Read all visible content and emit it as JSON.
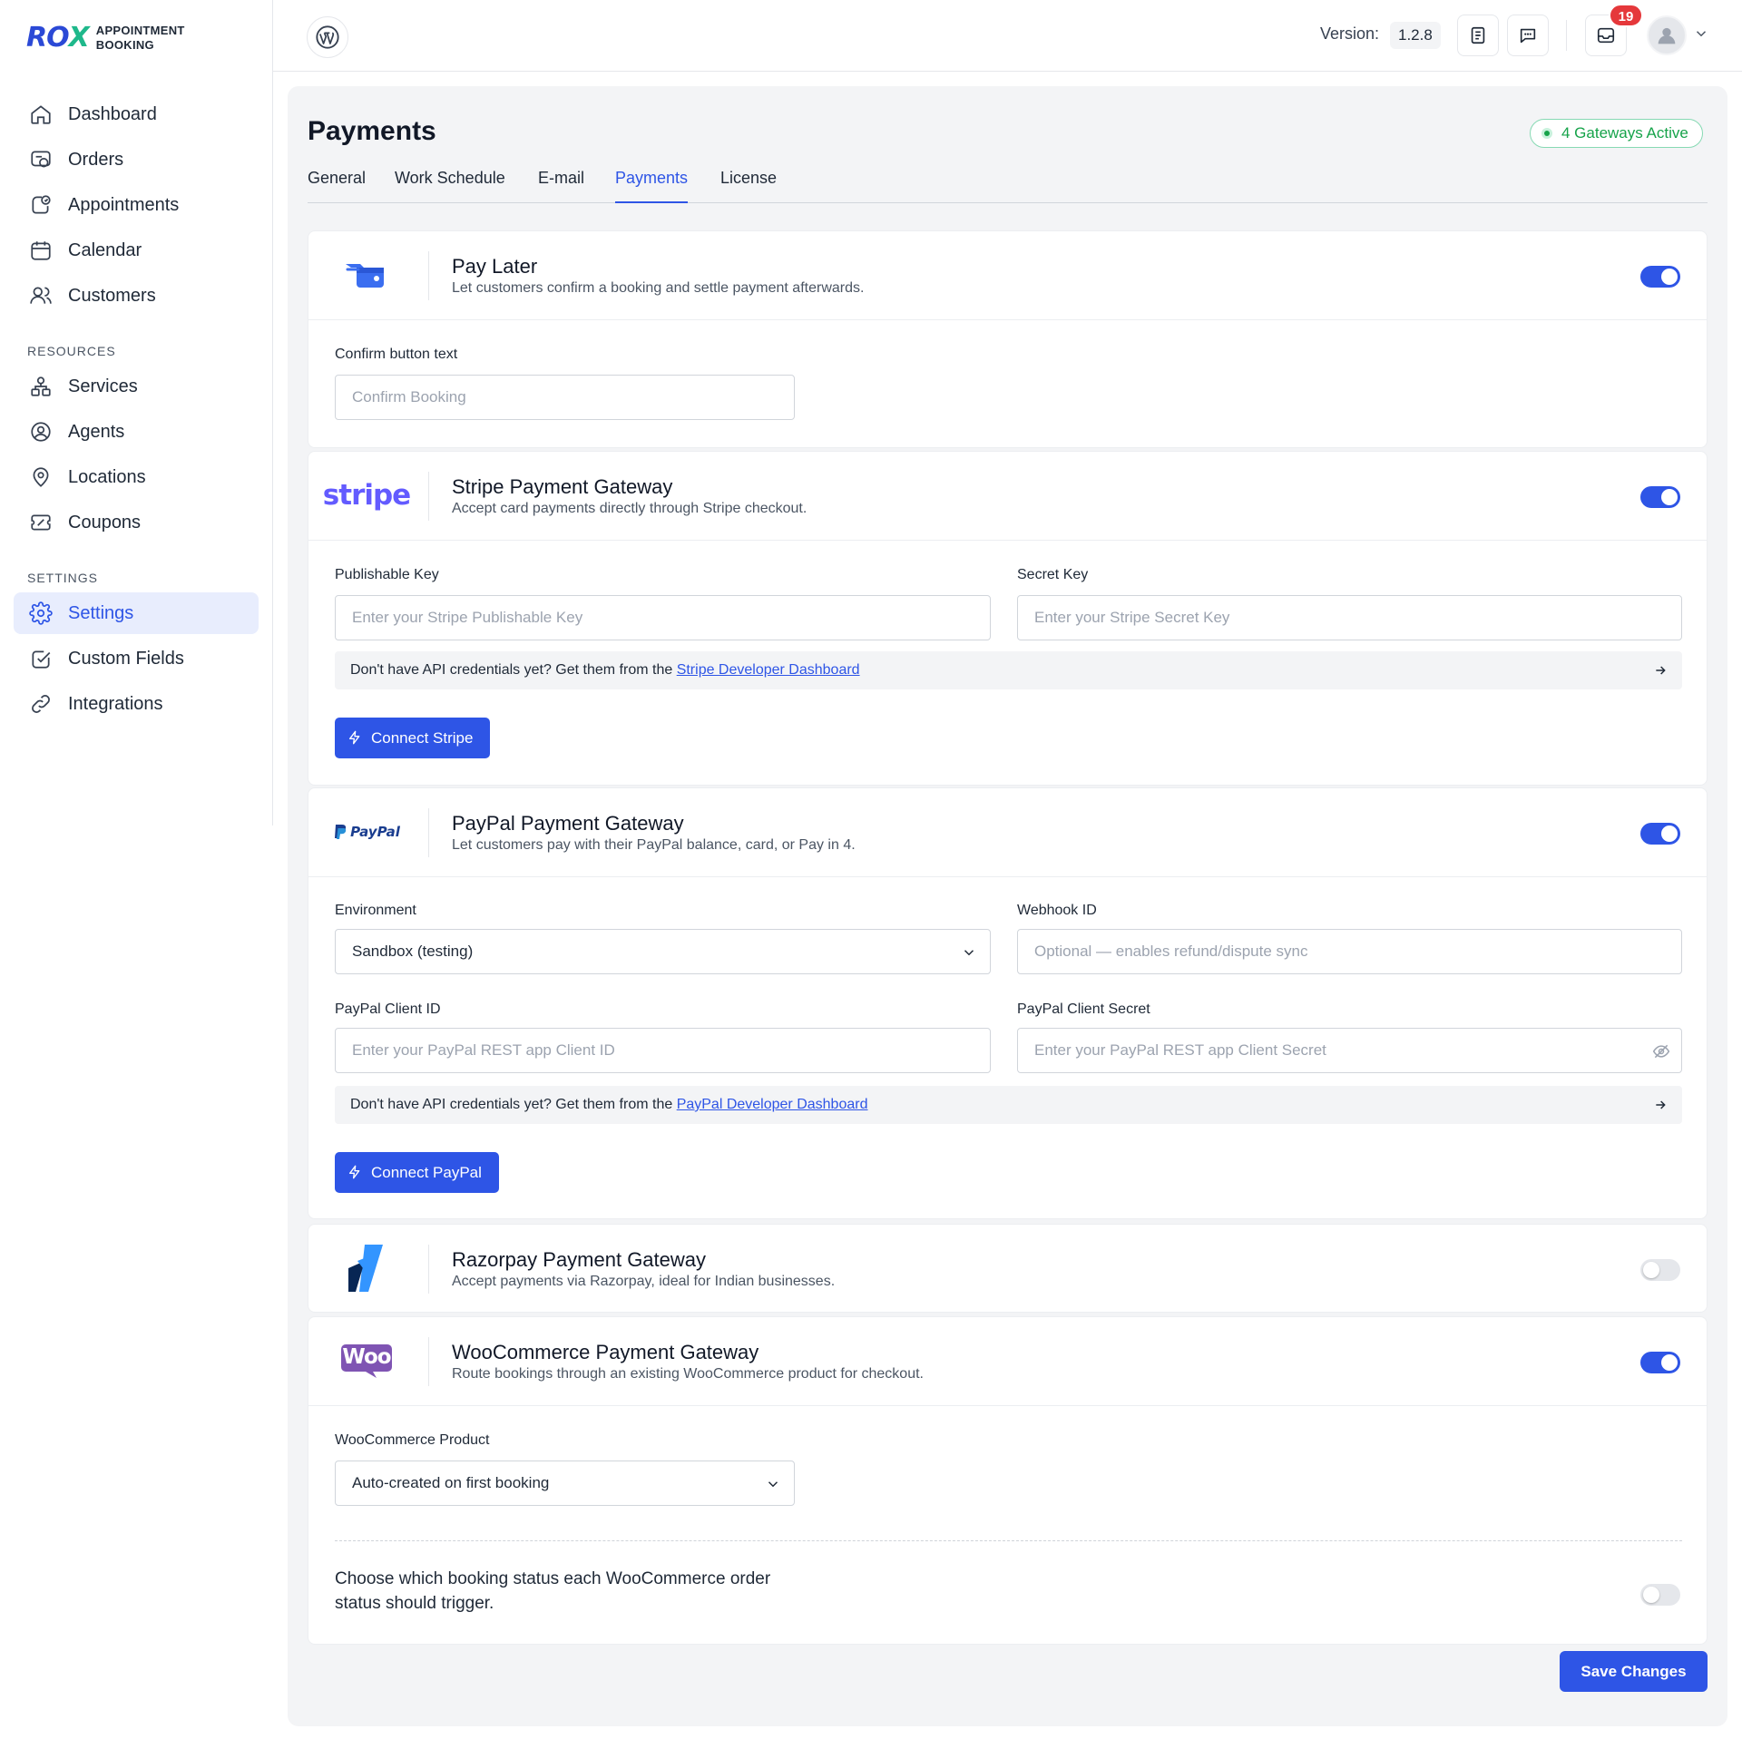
{
  "brand": {
    "mark_a": "RO",
    "mark_b": "X",
    "line1": "APPOINTMENT",
    "line2": "BOOKING"
  },
  "sidebar": {
    "main_items": [
      {
        "label": "Dashboard",
        "icon": "home-icon"
      },
      {
        "label": "Orders",
        "icon": "orders-icon"
      },
      {
        "label": "Appointments",
        "icon": "appointments-icon"
      },
      {
        "label": "Calendar",
        "icon": "calendar-icon"
      },
      {
        "label": "Customers",
        "icon": "customers-icon"
      }
    ],
    "resources_heading": "RESOURCES",
    "resource_items": [
      {
        "label": "Services",
        "icon": "services-icon"
      },
      {
        "label": "Agents",
        "icon": "agent-icon"
      },
      {
        "label": "Locations",
        "icon": "location-pin-icon"
      },
      {
        "label": "Coupons",
        "icon": "coupon-icon"
      }
    ],
    "settings_heading": "SETTINGS",
    "settings_items": [
      {
        "label": "Settings",
        "icon": "gear-icon",
        "active": true
      },
      {
        "label": "Custom Fields",
        "icon": "checkbox-icon"
      },
      {
        "label": "Integrations",
        "icon": "link-icon"
      }
    ]
  },
  "topbar": {
    "version_label": "Version:",
    "version_value": "1.2.8",
    "notification_count": "19"
  },
  "page": {
    "title": "Payments",
    "active_badge": "4 Gateways Active",
    "tabs": [
      "General",
      "Work Schedule",
      "E-mail",
      "Payments",
      "License"
    ],
    "active_tab": "Payments"
  },
  "pay_later": {
    "title": "Pay Later",
    "description": "Let customers confirm a booking and settle payment afterwards.",
    "enabled": true,
    "confirm_label": "Confirm button text",
    "confirm_placeholder": "Confirm Booking"
  },
  "stripe": {
    "logo_text": "stripe",
    "title": "Stripe Payment Gateway",
    "description": "Accept card payments directly through Stripe checkout.",
    "enabled": true,
    "publishable_label": "Publishable Key",
    "publishable_placeholder": "Enter your Stripe Publishable Key",
    "secret_label": "Secret Key",
    "secret_placeholder": "Enter your Stripe Secret Key",
    "hint_text": "Don't have API credentials yet? Get them from the ",
    "hint_link": "Stripe Developer Dashboard",
    "button": "Connect Stripe"
  },
  "paypal": {
    "logo_text": "PayPal",
    "title": "PayPal Payment Gateway",
    "description": "Let customers pay with their PayPal balance, card, or Pay in 4.",
    "enabled": true,
    "environment_label": "Environment",
    "environment_value": "Sandbox (testing)",
    "webhook_label": "Webhook ID",
    "webhook_placeholder": "Optional — enables refund/dispute sync",
    "client_id_label": "PayPal Client ID",
    "client_id_placeholder": "Enter your PayPal REST app Client ID",
    "client_secret_label": "PayPal Client Secret",
    "client_secret_placeholder": "Enter your PayPal REST app Client Secret",
    "hint_text": "Don't have API credentials yet? Get them from the ",
    "hint_link": "PayPal Developer Dashboard",
    "button": "Connect PayPal"
  },
  "razorpay": {
    "title": "Razorpay Payment Gateway",
    "description": "Accept payments via Razorpay, ideal for Indian businesses.",
    "enabled": false
  },
  "woocommerce": {
    "logo_text": "Woo",
    "title": "WooCommerce Payment Gateway",
    "description": "Route bookings through an existing WooCommerce product for checkout.",
    "enabled": true,
    "product_label": "WooCommerce Product",
    "product_value": "Auto-created on first booking",
    "status_text_line1": "Choose which booking status each WooCommerce order",
    "status_text_line2": "status should trigger.",
    "status_mapping_enabled": false
  },
  "footer": {
    "save_button": "Save Changes"
  },
  "colors": {
    "accent": "#2e55e6",
    "success": "#16a34a",
    "danger": "#e5383b",
    "stripe": "#635bff",
    "woo": "#7f54b3"
  }
}
